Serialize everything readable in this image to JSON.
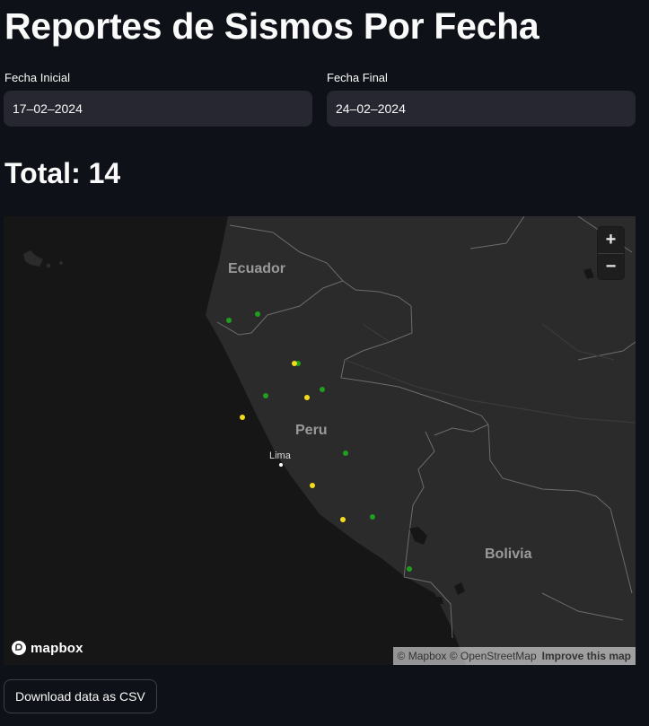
{
  "page": {
    "title": "Reportes de Sismos Por Fecha"
  },
  "filters": {
    "start_label": "Fecha Inicial",
    "start_value": "17–02–2024",
    "end_label": "Fecha Final",
    "end_value": "24–02–2024"
  },
  "summary": {
    "total_text": "Total: 14"
  },
  "map": {
    "labels": {
      "ecuador": "Ecuador",
      "peru": "Peru",
      "bolivia": "Bolivia",
      "lima": "Lima"
    },
    "zoom_in": "+",
    "zoom_out": "−",
    "logo_text": "mapbox",
    "attribution": "© Mapbox © OpenStreetMap",
    "improve_link": "Improve this map",
    "marker_colors": {
      "green": "#1f9e1f",
      "yellow": "#f2dc1c"
    }
  },
  "actions": {
    "download_label": "Download data as CSV"
  }
}
